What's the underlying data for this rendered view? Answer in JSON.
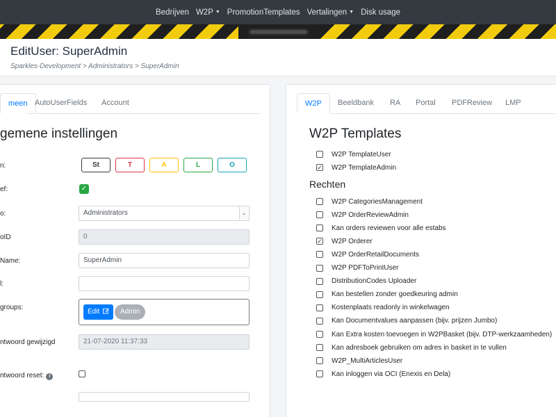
{
  "nav": {
    "items": [
      {
        "label": "Bedrijven",
        "dropdown": false
      },
      {
        "label": "W2P",
        "dropdown": true
      },
      {
        "label": "PromotionTemplates",
        "dropdown": false
      },
      {
        "label": "Vertalingen",
        "dropdown": true
      },
      {
        "label": "Disk usage",
        "dropdown": false
      }
    ]
  },
  "header": {
    "title": "EditUser: SuperAdmin",
    "breadcrumb": "Sparkles-Development > Administrators > SuperAdmin"
  },
  "left": {
    "tabs": [
      "meen",
      "AutoUserFields",
      "Account"
    ],
    "active_tab": 0,
    "section_title": "gemene instellingen",
    "fields": {
      "letters_label": "n:",
      "active_label": "ef:",
      "group_label": "o:",
      "group_value": "Administrators",
      "group_id_label": "oID",
      "group_id_value": "0",
      "username_label": "Name:",
      "username_value": "SuperAdmin",
      "email_label": "l:",
      "email_value": "",
      "usergroups_label": "groups:",
      "usergroups_edit": "Edit",
      "usergroups_tag": "Admin",
      "pw_changed_label": "ntwoord gewijzigd",
      "pw_changed_value": "21-07-2020 11:37:33",
      "pw_reset_label": "ntwoord reset:"
    },
    "letter_buttons": [
      {
        "label": "St",
        "color": "#343a40"
      },
      {
        "label": "T",
        "color": "#dc3545"
      },
      {
        "label": "A",
        "color": "#ffc107"
      },
      {
        "label": "L",
        "color": "#28a745"
      },
      {
        "label": "O",
        "color": "#17a2b8"
      }
    ]
  },
  "right": {
    "tabs": [
      "W2P",
      "Beeldbank",
      "RA",
      "Portal",
      "PDFReview",
      "LMP"
    ],
    "active_tab": 0,
    "section_title": "W2P Templates",
    "templates": [
      {
        "label": "W2P TemplateUser",
        "checked": false
      },
      {
        "label": "W2P TemplateAdmin",
        "checked": true
      }
    ],
    "rights_title": "Rechten",
    "rights": [
      {
        "label": "W2P CategoriesManagement",
        "checked": false
      },
      {
        "label": "W2P OrderReviewAdmin",
        "checked": false
      },
      {
        "label": "Kan orders reviewen voor alle estabs",
        "checked": false
      },
      {
        "label": "W2P Orderer",
        "checked": true
      },
      {
        "label": "W2P OrderRetailDocuments",
        "checked": false
      },
      {
        "label": "W2P PDFToPrintUser",
        "checked": false
      },
      {
        "label": "DistributionCodes Uploader",
        "checked": false
      },
      {
        "label": "Kan bestellen zonder goedkeuring admin",
        "checked": false
      },
      {
        "label": "Kostenplaats readonly in winkelwagen",
        "checked": false
      },
      {
        "label": "Kan Documentvalues aanpassen (bijv. prijzen Jumbo)",
        "checked": false
      },
      {
        "label": "Kan Extra kosten toevoegen in W2PBasket (bijv. DTP-werkzaamheden)",
        "checked": false
      },
      {
        "label": "Kan adresboek gebruiken om adres in basket in te vullen",
        "checked": false
      },
      {
        "label": "W2P_MultiArticlesUser",
        "checked": false
      },
      {
        "label": "Kan inloggen via OCI (Enexis en Dela)",
        "checked": false
      }
    ]
  },
  "colors": {
    "accent": "#007bff",
    "navbar": "#343a40",
    "stripe_yellow": "#f2cc0c",
    "success": "#28a745"
  }
}
